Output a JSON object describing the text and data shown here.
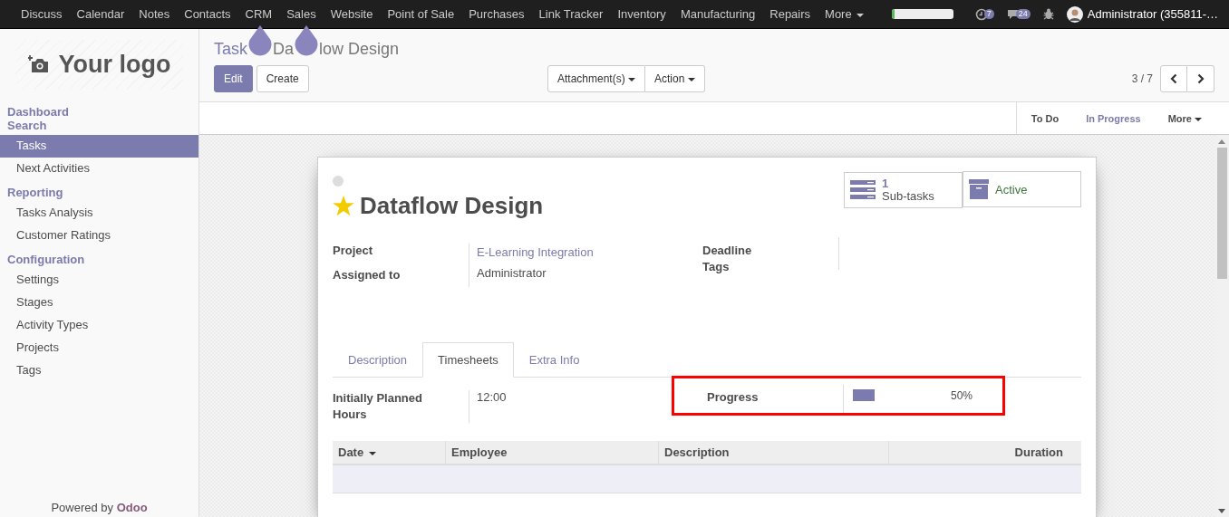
{
  "top_menu": [
    {
      "label": "Discuss"
    },
    {
      "label": "Calendar"
    },
    {
      "label": "Notes"
    },
    {
      "label": "Contacts"
    },
    {
      "label": "CRM"
    },
    {
      "label": "Sales"
    },
    {
      "label": "Website"
    },
    {
      "label": "Point of Sale"
    },
    {
      "label": "Purchases"
    },
    {
      "label": "Link Tracker"
    },
    {
      "label": "Inventory"
    },
    {
      "label": "Manufacturing"
    },
    {
      "label": "Repairs"
    }
  ],
  "more_menu": "More",
  "systray": {
    "onboarding": {
      "level": 0.05
    },
    "activities_badge": "7",
    "messages_badge": "24",
    "user": "Administrator (355811-…"
  },
  "sidebar": {
    "logo": "Your logo",
    "sections": [
      {
        "title": "Dashboard"
      },
      {
        "title": "Search",
        "items": [
          {
            "label": "Tasks",
            "selected": true
          },
          {
            "label": "Next Activities",
            "selected": false
          }
        ]
      },
      {
        "title": "Reporting",
        "items": [
          {
            "label": "Tasks Analysis",
            "selected": false
          },
          {
            "label": "Customer Ratings",
            "selected": false
          }
        ]
      },
      {
        "title": "Configuration",
        "items": [
          {
            "label": "Settings",
            "selected": false
          },
          {
            "label": "Stages",
            "selected": false
          },
          {
            "label": "Activity Types",
            "selected": false
          },
          {
            "label": "Projects",
            "selected": false
          },
          {
            "label": "Tags",
            "selected": false
          }
        ]
      }
    ],
    "footer_prefix": "Powered by",
    "footer_brand": "Odoo"
  },
  "breadcrumb": {
    "parent": "Task",
    "current_parts": [
      "Da",
      "low Design"
    ]
  },
  "buttons": {
    "edit": "Edit",
    "create": "Create",
    "attachments": "Attachment(s)",
    "action": "Action"
  },
  "pager": "3 / 7",
  "stages": [
    {
      "label": "To Do",
      "selected": false
    },
    {
      "label": "In Progress",
      "selected": true
    }
  ],
  "stages_more": "More",
  "record": {
    "kanban_state_blocked": false,
    "starred": true,
    "title": "Dataflow Design",
    "smart_buttons": {
      "subtasks_count": "1",
      "subtasks_label": "Sub-tasks",
      "active_label": "Active"
    },
    "left_fields": [
      {
        "label": "Project",
        "value": "E-Learning Integration",
        "kind": "link"
      },
      {
        "label": "Assigned to",
        "value": "Administrator",
        "kind": "text"
      }
    ],
    "right_fields": [
      {
        "label": "Deadline"
      },
      {
        "label": "Tags"
      }
    ],
    "tabs": [
      {
        "label": "Description",
        "selected": false
      },
      {
        "label": "Timesheets",
        "selected": true
      },
      {
        "label": "Extra Info",
        "selected": false
      }
    ],
    "planned_label": "Initially Planned Hours",
    "planned_value": "12:00",
    "progress": {
      "label": "Progress",
      "level": 0.5,
      "reading": "50%",
      "highlighted": true
    },
    "table": {
      "columns": [
        {
          "label": "Date",
          "sorted": true
        },
        {
          "label": "Employee",
          "sorted": false
        },
        {
          "label": "Description",
          "sorted": false
        },
        {
          "label": "Duration",
          "sorted": false
        }
      ]
    }
  }
}
